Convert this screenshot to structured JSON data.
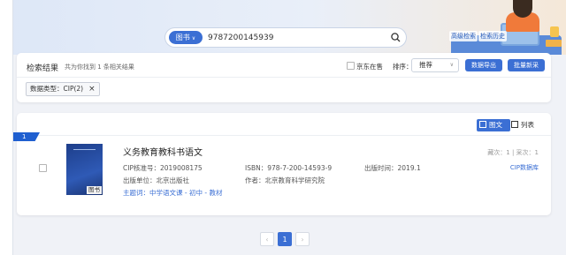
{
  "search": {
    "type_label": "图书",
    "query": "9787200145939"
  },
  "advanced_links": {
    "advanced_search": "高级检索",
    "history": "检索历史"
  },
  "results_header": {
    "title": "检索结果",
    "count_text": "共为你找到 1 条相关结果",
    "jd_filter_label": "京东在售",
    "sort_label": "排序：",
    "sort_value": "推荐",
    "export_button": "数据导出",
    "batch_button": "批量新采"
  },
  "active_filter": {
    "label": "数据类型：CIP(2)",
    "close": "×"
  },
  "view": {
    "grid_label": "图文",
    "list_label": "列表"
  },
  "result": {
    "index": "1",
    "cover_tag": "图书",
    "title": "义务教育教科书语文",
    "cip_label": "CIP核准号：",
    "cip_value": "2019008175",
    "isbn_label": "ISBN：",
    "isbn_value": "978-7-200-14593-9",
    "pubdate_label": "出版时间：",
    "pubdate_value": "2019.1",
    "publisher_label": "出版单位：",
    "publisher_value": "北京出版社",
    "author_label": "作者：",
    "author_value": "北京教育科学研究院",
    "subject_label": "主题词：",
    "subject_value": "中学语文课 - 初中 - 教材",
    "stats": "藏次：1 | 采次：1",
    "source": "CIP数据库"
  },
  "pagination": {
    "prev": "‹",
    "current": "1",
    "next": "›"
  },
  "colors": {
    "primary": "#3b6fd4",
    "badge": "#1f5fd0"
  }
}
